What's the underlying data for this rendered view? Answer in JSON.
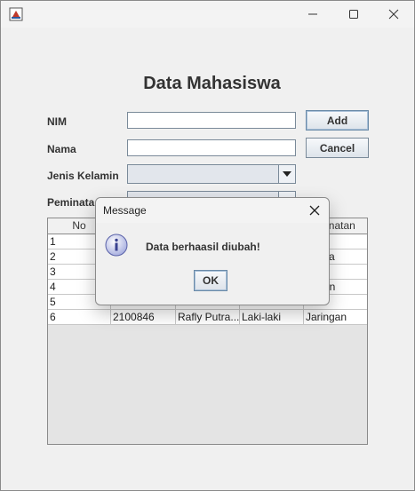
{
  "window": {
    "title": ""
  },
  "form": {
    "heading": "Data Mahasiswa",
    "nim_label": "NIM",
    "nama_label": "Nama",
    "jenis_kelamin_label": "Jenis Kelamin",
    "peminatan_label": "Peminata",
    "nim_value": "",
    "nama_value": "",
    "jenis_kelamin_value": "",
    "peminatan_value": ""
  },
  "buttons": {
    "add": "Add",
    "cancel": "Cancel"
  },
  "table": {
    "headers": [
      "No",
      "",
      "",
      "",
      "minatan"
    ],
    "rows": [
      [
        "1",
        "",
        "",
        "",
        ""
      ],
      [
        "2",
        "",
        "",
        "",
        "media"
      ],
      [
        "3",
        "",
        "",
        "",
        ""
      ],
      [
        "4",
        "",
        "",
        "",
        "ringan"
      ],
      [
        "5",
        "",
        "",
        "",
        ""
      ],
      [
        "6",
        "2100846",
        "Rafly Putra...",
        "Laki-laki",
        "Jaringan"
      ]
    ]
  },
  "dialog": {
    "title": "Message",
    "message": "Data berhaasil diubah!",
    "ok_label": "OK"
  },
  "icons": [
    "java-app-icon",
    "minimize-icon",
    "maximize-icon",
    "close-icon",
    "info-icon",
    "dropdown-arrow-icon"
  ]
}
